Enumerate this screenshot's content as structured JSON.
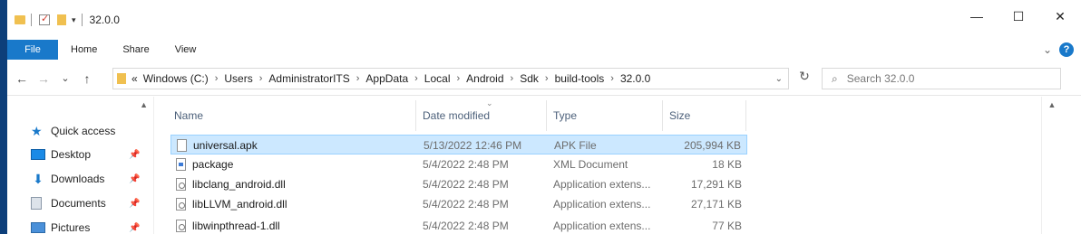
{
  "window": {
    "title": "32.0.0",
    "controls": {
      "minimize": "—",
      "maximize": "☐",
      "close": "✕"
    }
  },
  "ribbon": {
    "tabs": [
      "File",
      "Home",
      "Share",
      "View"
    ],
    "expand_icon": "chevron-down",
    "help_label": "?"
  },
  "nav": {
    "back": "←",
    "forward": "→",
    "recent": "⌄",
    "up": "↑",
    "refresh": "↻",
    "breadcrumb_prefix": "«",
    "breadcrumb": [
      "Windows (C:)",
      "Users",
      "AdministratorITS",
      "AppData",
      "Local",
      "Android",
      "Sdk",
      "build-tools",
      "32.0.0"
    ],
    "search_placeholder": "Search 32.0.0"
  },
  "navpane": {
    "items": [
      {
        "label": "Quick access",
        "icon": "star-icon",
        "pinned": false
      },
      {
        "label": "Desktop",
        "icon": "desktop-icon",
        "pinned": true
      },
      {
        "label": "Downloads",
        "icon": "download-icon",
        "pinned": true
      },
      {
        "label": "Documents",
        "icon": "documents-icon",
        "pinned": true
      },
      {
        "label": "Pictures",
        "icon": "pictures-icon",
        "pinned": true
      }
    ]
  },
  "filelist": {
    "columns": {
      "name": "Name",
      "date": "Date modified",
      "type": "Type",
      "size": "Size"
    },
    "rows": [
      {
        "name": "universal.apk",
        "date": "5/13/2022 12:46 PM",
        "type": "APK File",
        "size": "205,994 KB",
        "selected": true,
        "icon": "file-icon"
      },
      {
        "name": "package",
        "date": "5/4/2022 2:48 PM",
        "type": "XML Document",
        "size": "18 KB",
        "selected": false,
        "icon": "xml-file-icon"
      },
      {
        "name": "libclang_android.dll",
        "date": "5/4/2022 2:48 PM",
        "type": "Application extens...",
        "size": "17,291 KB",
        "selected": false,
        "icon": "dll-file-icon"
      },
      {
        "name": "libLLVM_android.dll",
        "date": "5/4/2022 2:48 PM",
        "type": "Application extens...",
        "size": "27,171 KB",
        "selected": false,
        "icon": "dll-file-icon"
      },
      {
        "name": "libwinpthread-1.dll",
        "date": "5/4/2022 2:48 PM",
        "type": "Application extens...",
        "size": "77 KB",
        "selected": false,
        "icon": "dll-file-icon"
      }
    ]
  },
  "colors": {
    "accent": "#1979ca",
    "selection": "#cce8ff",
    "desktop": "#1565c0"
  }
}
